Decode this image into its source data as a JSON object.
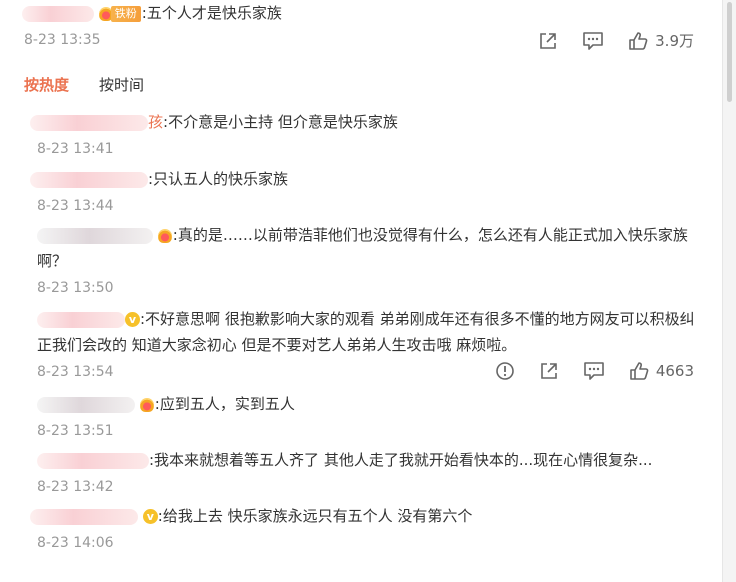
{
  "top_comment": {
    "badge_label": "铁粉",
    "text": ":五个人才是快乐家族",
    "time": "8-23 13:35",
    "like_count": "3.9万"
  },
  "tabs": {
    "hot": "按热度",
    "time": "按时间"
  },
  "replies": [
    {
      "name_peek": "孩",
      "text": ":不介意是小主持 但介意是快乐家族",
      "time": "8-23 13:41"
    },
    {
      "name_peek": "",
      "text": ":只认五人的快乐家族",
      "time": "8-23 13:44"
    },
    {
      "name_peek": "",
      "text": ":真的是……以前带浩菲他们也没觉得有什么，怎么还有人能正式加入快乐家族啊？",
      "time": "8-23 13:50"
    },
    {
      "name_peek": "",
      "text": ":不好意思啊 很抱歉影响大家的观看 弟弟刚成年还有很多不懂的地方网友可以积极纠正我们会改的 知道大家念初心 但是不要对艺人弟弟人生攻击哦 麻烦啦。",
      "time": "8-23 13:54",
      "like_count": "4663"
    },
    {
      "name_peek": "",
      "text": ":应到五人，实到五人",
      "time": "8-23 13:51"
    },
    {
      "name_peek": "",
      "text": ":我本来就想着等五人齐了 其他人走了我就开始看快本的...现在心情很复杂...",
      "time": "8-23 13:42"
    },
    {
      "name_peek": "",
      "text": ":给我上去 快乐家族永远只有五个人 没有第六个",
      "time": "8-23 14:06"
    }
  ],
  "icons": {
    "share": "share-icon",
    "comment": "comment-icon",
    "like": "thumbs-up-icon",
    "report": "report-icon"
  },
  "colors": {
    "accent": "#eb7350",
    "time": "#999999",
    "text": "#333333"
  }
}
